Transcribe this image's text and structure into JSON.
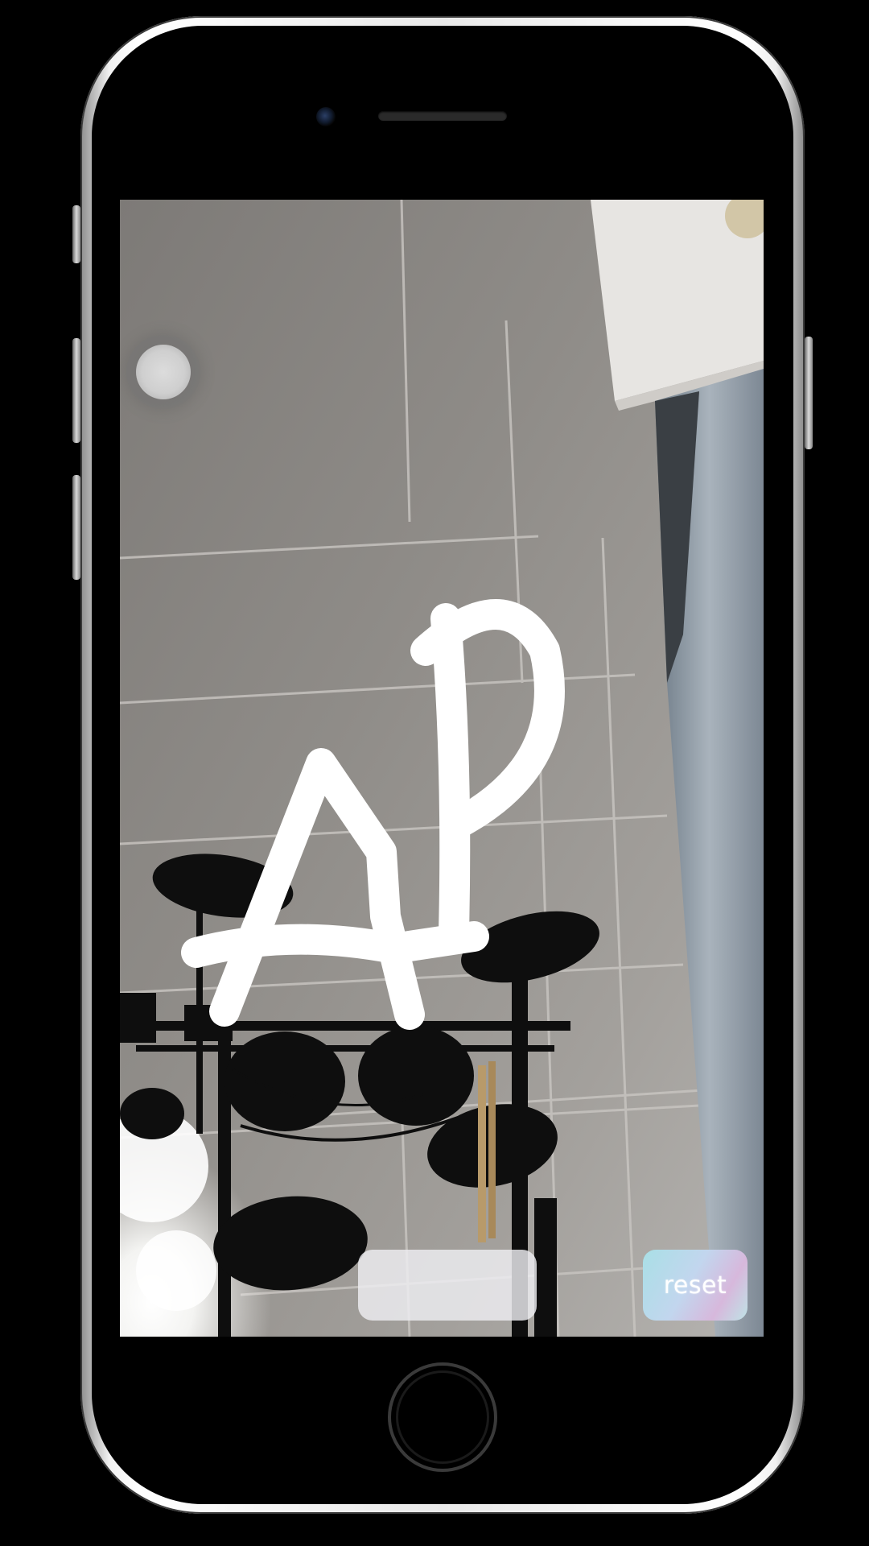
{
  "device": {
    "model": "iPhone",
    "frame_color": "#e9e9e9"
  },
  "ar_view": {
    "drawn_text": "AP",
    "drawing_color": "#ffffff",
    "icons": {
      "capture": "record-circle-icon"
    }
  },
  "controls": {
    "blank_button_label": "",
    "reset_button_label": "reset",
    "reset_gradient": [
      "#a9dfe6",
      "#d7b8dc"
    ]
  }
}
